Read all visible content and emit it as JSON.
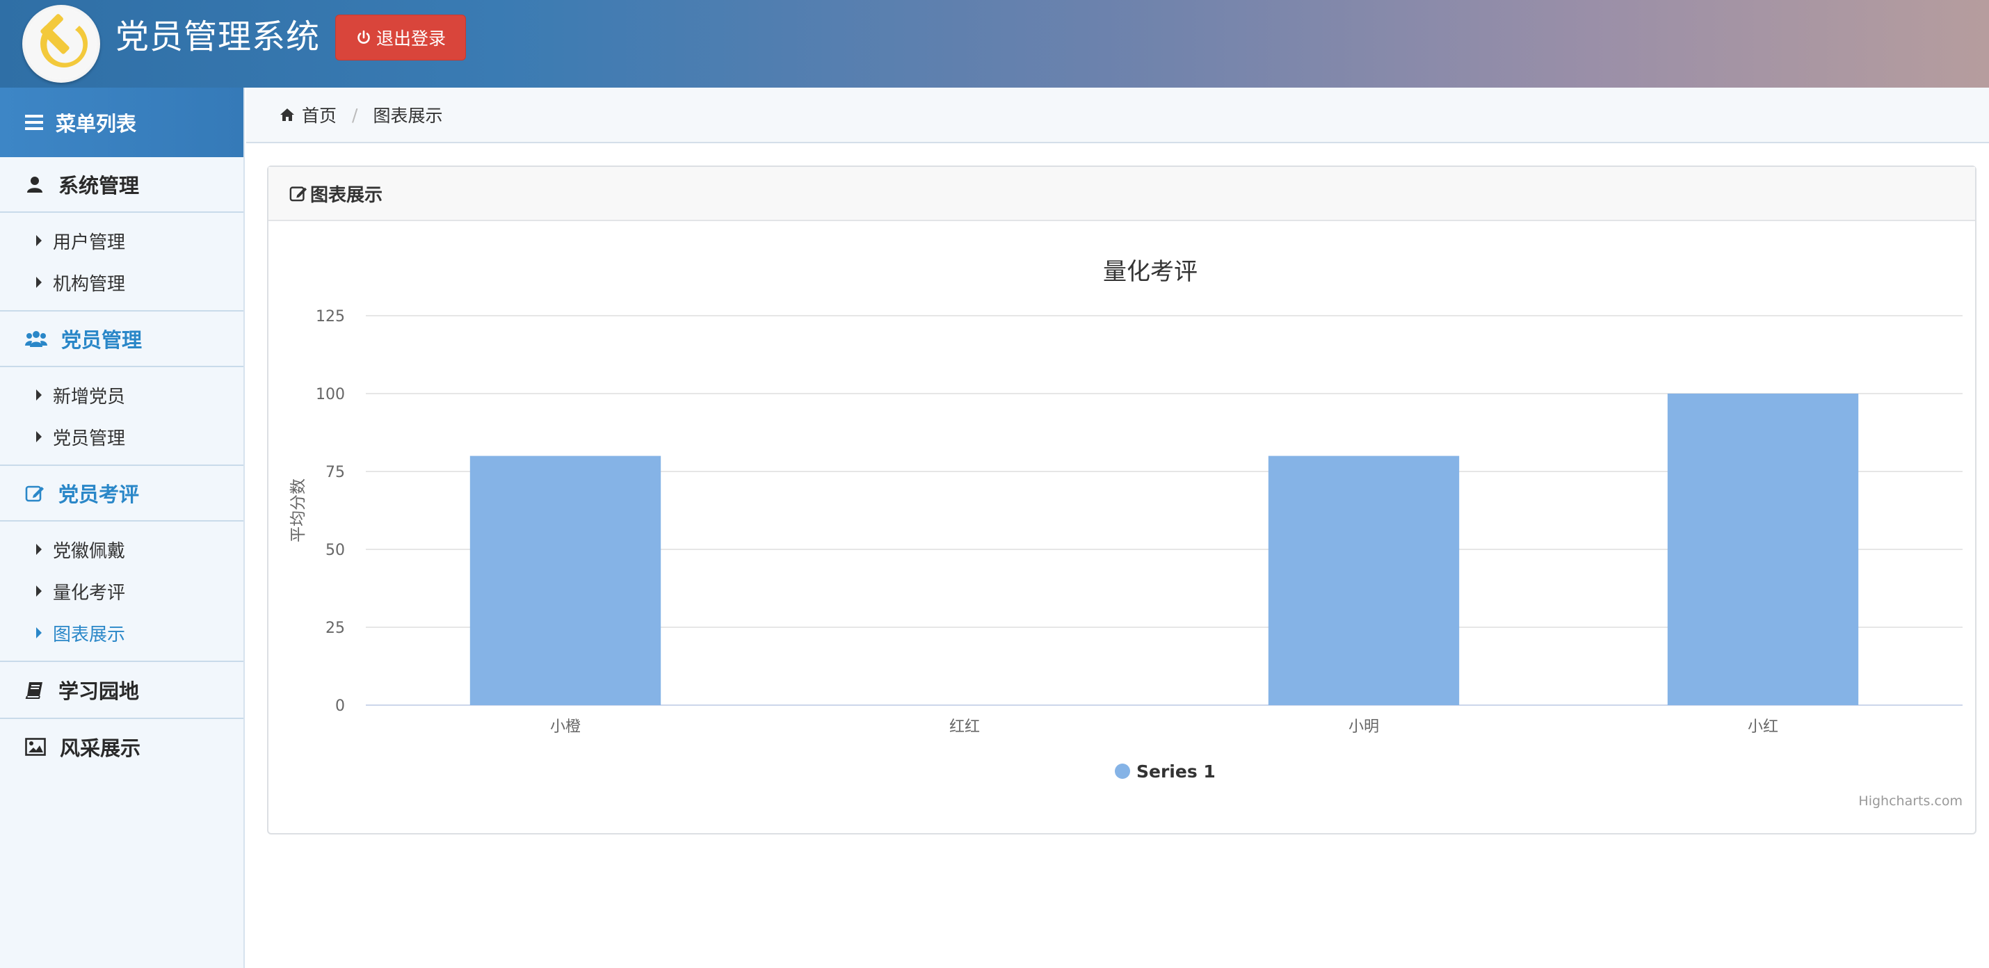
{
  "header": {
    "app_title": "党员管理系统",
    "logout_label": "退出登录"
  },
  "sidebar": {
    "menu_title": "菜单列表",
    "groups": [
      {
        "title": "系统管理",
        "icon": "user-icon",
        "active": false,
        "items": [
          {
            "label": "用户管理",
            "active": false
          },
          {
            "label": "机构管理",
            "active": false
          }
        ]
      },
      {
        "title": "党员管理",
        "icon": "users-icon",
        "active": true,
        "items": [
          {
            "label": "新增党员",
            "active": false
          },
          {
            "label": "党员管理",
            "active": false
          }
        ]
      },
      {
        "title": "党员考评",
        "icon": "edit-icon",
        "active": true,
        "items": [
          {
            "label": "党徽佩戴",
            "active": false
          },
          {
            "label": "量化考评",
            "active": false
          },
          {
            "label": "图表展示",
            "active": true
          }
        ]
      },
      {
        "title": "学习园地",
        "icon": "book-icon",
        "active": false,
        "items": []
      },
      {
        "title": "风采展示",
        "icon": "picture-icon",
        "active": false,
        "items": []
      }
    ]
  },
  "breadcrumb": {
    "home": "首页",
    "current": "图表展示"
  },
  "panel": {
    "title": "图表展示"
  },
  "chart_data": {
    "type": "bar",
    "title": "量化考评",
    "categories": [
      "小橙",
      "红红",
      "小明",
      "小红"
    ],
    "series": [
      {
        "name": "Series 1",
        "values": [
          80,
          0,
          80,
          100
        ],
        "color": "#85b3e6"
      }
    ],
    "ylabel": "平均分数",
    "xlabel": "",
    "ylim": [
      0,
      125
    ],
    "yticks": [
      0,
      25,
      50,
      75,
      100,
      125
    ],
    "grid": true,
    "legend": "bottom-center",
    "credits": "Highcharts.com"
  },
  "colors": {
    "accent": "#2a87c8",
    "danger": "#d9453b",
    "bar": "#85b3e6"
  }
}
